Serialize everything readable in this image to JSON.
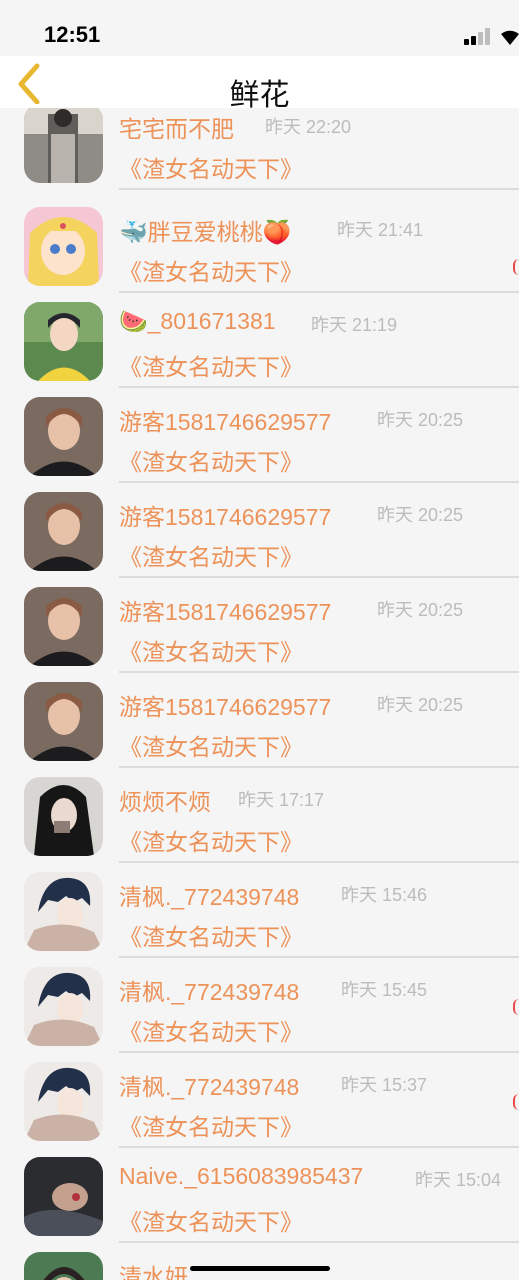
{
  "status_bar": {
    "time": "12:51"
  },
  "nav": {
    "title": "鲜花"
  },
  "gift_label": "《渣女名动天下》",
  "rows": [
    {
      "name": "宅宅而不肥",
      "time": "昨天 22:20",
      "avatar": "woman-dress-photo"
    },
    {
      "name": "🐳胖豆爱桃桃🍑",
      "time": "昨天 21:41",
      "avatar": "anime-sailor-moon"
    },
    {
      "name": "🍉_801671381",
      "time": "昨天 21:19",
      "avatar": "man-yellow-shirt"
    },
    {
      "name": "游客1581746629577",
      "time": "昨天 20:25",
      "avatar": "woman-bangs-photo"
    },
    {
      "name": "游客1581746629577",
      "time": "昨天 20:25",
      "avatar": "woman-bangs-photo"
    },
    {
      "name": "游客1581746629577",
      "time": "昨天 20:25",
      "avatar": "woman-bangs-photo"
    },
    {
      "name": "游客1581746629577",
      "time": "昨天 20:25",
      "avatar": "woman-bangs-photo"
    },
    {
      "name": "烦烦不烦",
      "time": "昨天 17:17",
      "avatar": "woman-long-hair-photo"
    },
    {
      "name": "清枫._772439748",
      "time": "昨天 15:46",
      "avatar": "illustrated-boy"
    },
    {
      "name": "清枫._772439748",
      "time": "昨天 15:45",
      "avatar": "illustrated-boy"
    },
    {
      "name": "清枫._772439748",
      "time": "昨天 15:37",
      "avatar": "illustrated-boy"
    },
    {
      "name": "Naive._6156083985437",
      "time": "昨天 15:04",
      "avatar": "dark-photo"
    },
    {
      "name": "清水妍",
      "time": "",
      "avatar": "partial-photo"
    }
  ],
  "colors": {
    "name": "#ed9259",
    "time": "#bcbcbc",
    "divider": "#dcdcdc",
    "accent": "#e8b730"
  }
}
